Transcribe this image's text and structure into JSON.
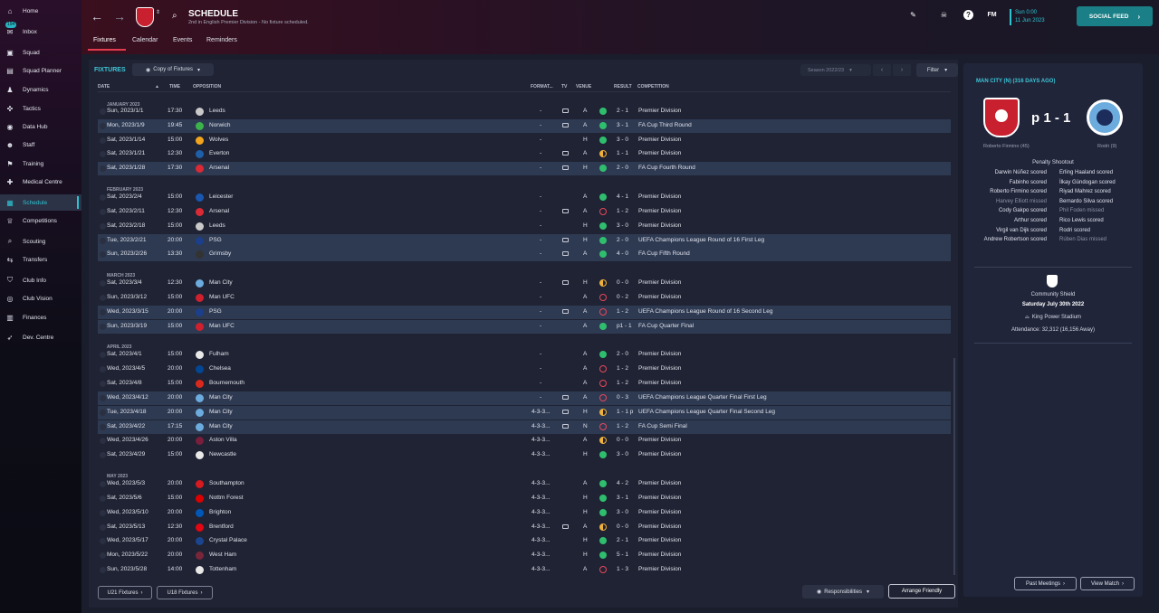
{
  "sidebar": {
    "items": [
      {
        "label": "Home",
        "icon": "home-icon",
        "glyph": "⌂"
      },
      {
        "label": "Inbox",
        "icon": "inbox-icon",
        "glyph": "✉",
        "badge": "194"
      },
      {
        "label": "Squad",
        "icon": "squad-icon",
        "glyph": "▣"
      },
      {
        "label": "Squad Planner",
        "icon": "squad-planner-icon",
        "glyph": "▤"
      },
      {
        "label": "Dynamics",
        "icon": "dynamics-icon",
        "glyph": "♟"
      },
      {
        "label": "Tactics",
        "icon": "tactics-icon",
        "glyph": "✜"
      },
      {
        "label": "Data Hub",
        "icon": "data-hub-icon",
        "glyph": "◉"
      },
      {
        "label": "Staff",
        "icon": "staff-icon",
        "glyph": "☻"
      },
      {
        "label": "Training",
        "icon": "training-icon",
        "glyph": "⚑"
      },
      {
        "label": "Medical Centre",
        "icon": "medical-icon",
        "glyph": "✚"
      },
      {
        "label": "Schedule",
        "icon": "calendar-icon",
        "glyph": "▦"
      },
      {
        "label": "Competitions",
        "icon": "trophy-icon",
        "glyph": "♕"
      },
      {
        "label": "Scouting",
        "icon": "scouting-icon",
        "glyph": "⌕"
      },
      {
        "label": "Transfers",
        "icon": "transfers-icon",
        "glyph": "⇆"
      },
      {
        "label": "Club Info",
        "icon": "club-info-icon",
        "glyph": "⛉"
      },
      {
        "label": "Club Vision",
        "icon": "club-vision-icon",
        "glyph": "◎"
      },
      {
        "label": "Finances",
        "icon": "finances-icon",
        "glyph": "▥"
      },
      {
        "label": "Dev. Centre",
        "icon": "dev-centre-icon",
        "glyph": "➶"
      }
    ]
  },
  "header": {
    "title": "SCHEDULE",
    "subtitle": "2nd in English Premier Division - No fixture scheduled.",
    "tabs": [
      "Fixtures",
      "Calendar",
      "Events",
      "Reminders"
    ],
    "fm_label": "FM",
    "date_day": "Sun 0:00",
    "date": "11 Jun 2023",
    "social_feed": "SOCIAL FEED"
  },
  "fixtures": {
    "label": "FIXTURES",
    "copy_button": "Copy of Fixtures",
    "season": "Season 2022/23",
    "filter": "Filter",
    "columns": {
      "date": "DATE",
      "time": "TIME",
      "opposition": "OPPOSITION",
      "formation": "FORMAT...",
      "tv": "TV",
      "venue": "VENUE",
      "result": "RESULT",
      "competition": "COMPETITION"
    },
    "months": [
      "JANUARY 2023",
      "FEBRUARY 2023",
      "MARCH 2023",
      "APRIL 2023",
      "MAY 2023"
    ],
    "rows": [
      {
        "date": "Sun, 2023/1/1",
        "time": "17:30",
        "opp": "Leeds",
        "crest": "#c9c9c9",
        "form": "-",
        "tv": true,
        "venue": "A",
        "res": "w",
        "score": "2 - 1",
        "comp": "Premier Division",
        "hl": false
      },
      {
        "date": "Mon, 2023/1/9",
        "time": "19:45",
        "opp": "Norwich",
        "crest": "#3bb34a",
        "form": "-",
        "tv": true,
        "venue": "A",
        "res": "w",
        "score": "3 - 1",
        "comp": "FA Cup Third Round",
        "hl": true
      },
      {
        "date": "Sat, 2023/1/14",
        "time": "15:00",
        "opp": "Wolves",
        "crest": "#f2a51c",
        "form": "-",
        "tv": false,
        "venue": "H",
        "res": "w",
        "score": "3 - 0",
        "comp": "Premier Division",
        "hl": false
      },
      {
        "date": "Sat, 2023/1/21",
        "time": "12:30",
        "opp": "Everton",
        "crest": "#1f5fa8",
        "form": "-",
        "tv": true,
        "venue": "A",
        "res": "d",
        "score": "1 - 1",
        "comp": "Premier Division",
        "hl": false
      },
      {
        "date": "Sat, 2023/1/28",
        "time": "17:30",
        "opp": "Arsenal",
        "crest": "#db2a35",
        "form": "-",
        "tv": true,
        "venue": "H",
        "res": "w",
        "score": "2 - 0",
        "comp": "FA Cup Fourth Round",
        "hl": true
      },
      {
        "date": "Sat, 2023/2/4",
        "time": "15:00",
        "opp": "Leicester",
        "crest": "#1a57b0",
        "form": "-",
        "tv": false,
        "venue": "A",
        "res": "w",
        "score": "4 - 1",
        "comp": "Premier Division",
        "hl": false
      },
      {
        "date": "Sat, 2023/2/11",
        "time": "12:30",
        "opp": "Arsenal",
        "crest": "#db2a35",
        "form": "-",
        "tv": true,
        "venue": "A",
        "res": "l",
        "score": "1 - 2",
        "comp": "Premier Division",
        "hl": false
      },
      {
        "date": "Sat, 2023/2/18",
        "time": "15:00",
        "opp": "Leeds",
        "crest": "#c9c9c9",
        "form": "-",
        "tv": false,
        "venue": "H",
        "res": "w",
        "score": "3 - 0",
        "comp": "Premier Division",
        "hl": false
      },
      {
        "date": "Tue, 2023/2/21",
        "time": "20:00",
        "opp": "PSG",
        "crest": "#1b3f8b",
        "form": "-",
        "tv": true,
        "venue": "H",
        "res": "w",
        "score": "2 - 0",
        "comp": "UEFA Champions League Round of 16  First Leg",
        "hl": true
      },
      {
        "date": "Sun, 2023/2/26",
        "time": "13:30",
        "opp": "Grimsby",
        "crest": "#333333",
        "form": "-",
        "tv": true,
        "venue": "A",
        "res": "w",
        "score": "4 - 0",
        "comp": "FA Cup Fifth Round",
        "hl": true
      },
      {
        "date": "Sat, 2023/3/4",
        "time": "12:30",
        "opp": "Man City",
        "crest": "#6cabdd",
        "form": "-",
        "tv": true,
        "venue": "H",
        "res": "d",
        "score": "0 - 0",
        "comp": "Premier Division",
        "hl": false
      },
      {
        "date": "Sun, 2023/3/12",
        "time": "15:00",
        "opp": "Man UFC",
        "crest": "#d0202e",
        "form": "-",
        "tv": false,
        "venue": "A",
        "res": "l",
        "score": "0 - 2",
        "comp": "Premier Division",
        "hl": false
      },
      {
        "date": "Wed, 2023/3/15",
        "time": "20:00",
        "opp": "PSG",
        "crest": "#1b3f8b",
        "form": "-",
        "tv": true,
        "venue": "A",
        "res": "l",
        "score": "1 - 2",
        "comp": "UEFA Champions League Round of 16  Second Leg",
        "hl": true
      },
      {
        "date": "Sun, 2023/3/19",
        "time": "15:00",
        "opp": "Man UFC",
        "crest": "#d0202e",
        "form": "-",
        "tv": false,
        "venue": "A",
        "res": "w",
        "score": "p1 - 1",
        "comp": "FA Cup Quarter Final",
        "hl": true
      },
      {
        "date": "Sat, 2023/4/1",
        "time": "15:00",
        "opp": "Fulham",
        "crest": "#e8e8e8",
        "form": "-",
        "tv": false,
        "venue": "A",
        "res": "w",
        "score": "2 - 0",
        "comp": "Premier Division",
        "hl": false
      },
      {
        "date": "Wed, 2023/4/5",
        "time": "20:00",
        "opp": "Chelsea",
        "crest": "#034694",
        "form": "-",
        "tv": false,
        "venue": "A",
        "res": "l",
        "score": "1 - 2",
        "comp": "Premier Division",
        "hl": false
      },
      {
        "date": "Sat, 2023/4/8",
        "time": "15:00",
        "opp": "Bournemouth",
        "crest": "#da291c",
        "form": "-",
        "tv": false,
        "venue": "A",
        "res": "l",
        "score": "1 - 2",
        "comp": "Premier Division",
        "hl": false
      },
      {
        "date": "Wed, 2023/4/12",
        "time": "20:00",
        "opp": "Man City",
        "crest": "#6cabdd",
        "form": "-",
        "tv": true,
        "venue": "A",
        "res": "l",
        "score": "0 - 3",
        "comp": "UEFA Champions League Quarter Final First Leg",
        "hl": true
      },
      {
        "date": "Tue, 2023/4/18",
        "time": "20:00",
        "opp": "Man City",
        "crest": "#6cabdd",
        "form": "4-3-3...",
        "tv": true,
        "venue": "H",
        "res": "d",
        "score": "1 - 1 p",
        "comp": "UEFA Champions League Quarter Final Second Leg",
        "hl": true
      },
      {
        "date": "Sat, 2023/4/22",
        "time": "17:15",
        "opp": "Man City",
        "crest": "#6cabdd",
        "form": "4-3-3...",
        "tv": true,
        "venue": "N",
        "res": "l",
        "score": "1 - 2",
        "comp": "FA Cup Semi Final",
        "hl": true
      },
      {
        "date": "Wed, 2023/4/26",
        "time": "20:00",
        "opp": "Aston Villa",
        "crest": "#7a1e3c",
        "form": "4-3-3...",
        "tv": false,
        "venue": "A",
        "res": "d",
        "score": "0 - 0",
        "comp": "Premier Division",
        "hl": false
      },
      {
        "date": "Sat, 2023/4/29",
        "time": "15:00",
        "opp": "Newcastle",
        "crest": "#e8e8e8",
        "form": "4-3-3...",
        "tv": false,
        "venue": "H",
        "res": "w",
        "score": "3 - 0",
        "comp": "Premier Division",
        "hl": false
      },
      {
        "date": "Wed, 2023/5/3",
        "time": "20:00",
        "opp": "Southampton",
        "crest": "#d71920",
        "form": "4-3-3...",
        "tv": false,
        "venue": "A",
        "res": "w",
        "score": "4 - 2",
        "comp": "Premier Division",
        "hl": false
      },
      {
        "date": "Sat, 2023/5/6",
        "time": "15:00",
        "opp": "Nottm Forest",
        "crest": "#dd0000",
        "form": "4-3-3...",
        "tv": false,
        "venue": "H",
        "res": "w",
        "score": "3 - 1",
        "comp": "Premier Division",
        "hl": false
      },
      {
        "date": "Wed, 2023/5/10",
        "time": "20:00",
        "opp": "Brighton",
        "crest": "#0057b8",
        "form": "4-3-3...",
        "tv": false,
        "venue": "H",
        "res": "w",
        "score": "3 - 0",
        "comp": "Premier Division",
        "hl": false
      },
      {
        "date": "Sat, 2023/5/13",
        "time": "12:30",
        "opp": "Brentford",
        "crest": "#e30613",
        "form": "4-3-3...",
        "tv": true,
        "venue": "A",
        "res": "d",
        "score": "0 - 0",
        "comp": "Premier Division",
        "hl": false
      },
      {
        "date": "Wed, 2023/5/17",
        "time": "20:00",
        "opp": "Crystal Palace",
        "crest": "#1b458f",
        "form": "4-3-3...",
        "tv": false,
        "venue": "H",
        "res": "w",
        "score": "2 - 1",
        "comp": "Premier Division",
        "hl": false
      },
      {
        "date": "Mon, 2023/5/22",
        "time": "20:00",
        "opp": "West Ham",
        "crest": "#7a263a",
        "form": "4-3-3...",
        "tv": false,
        "venue": "H",
        "res": "w",
        "score": "5 - 1",
        "comp": "Premier Division",
        "hl": false
      },
      {
        "date": "Sun, 2023/5/28",
        "time": "14:00",
        "opp": "Tottenham",
        "crest": "#e8e8e8",
        "form": "4-3-3...",
        "tv": false,
        "venue": "A",
        "res": "l",
        "score": "1 - 3",
        "comp": "Premier Division",
        "hl": false
      }
    ],
    "u21": "U21 Fixtures",
    "u18": "U18 Fixtures",
    "responsibilities": "Responsibilities",
    "arrange": "Arrange Friendly"
  },
  "panel": {
    "title": "MAN CITY (N) (316 DAYS AGO)",
    "score": "p 1 - 1",
    "home_scorer": "Roberto Firmino (45)",
    "away_scorer": "Rodri (9)",
    "pens_title": "Penalty Shootout",
    "pens_left": [
      "Darwin Núñez scored",
      "Fabinho scored",
      "Roberto Firmino scored",
      "Harvey Elliott missed",
      "Cody Gakpo scored",
      "Arthur scored",
      "Virgil van Dijk scored",
      "Andrew Robertson scored"
    ],
    "pens_right": [
      "Erling Haaland scored",
      "İlkay Gündogan scored",
      "Riyad Mahrez scored",
      "Bernardo Silva scored",
      "Phil Foden missed",
      "Rico Lewis scored",
      "Rodri scored",
      "Rúben Dias missed"
    ],
    "competition": "Community Shield",
    "match_date": "Saturday July 30th 2022",
    "stadium": "King Power Stadium",
    "attendance": "Attendance: 32,312 (16,156 Away)",
    "past_meetings": "Past Meetings",
    "view_match": "View Match"
  }
}
